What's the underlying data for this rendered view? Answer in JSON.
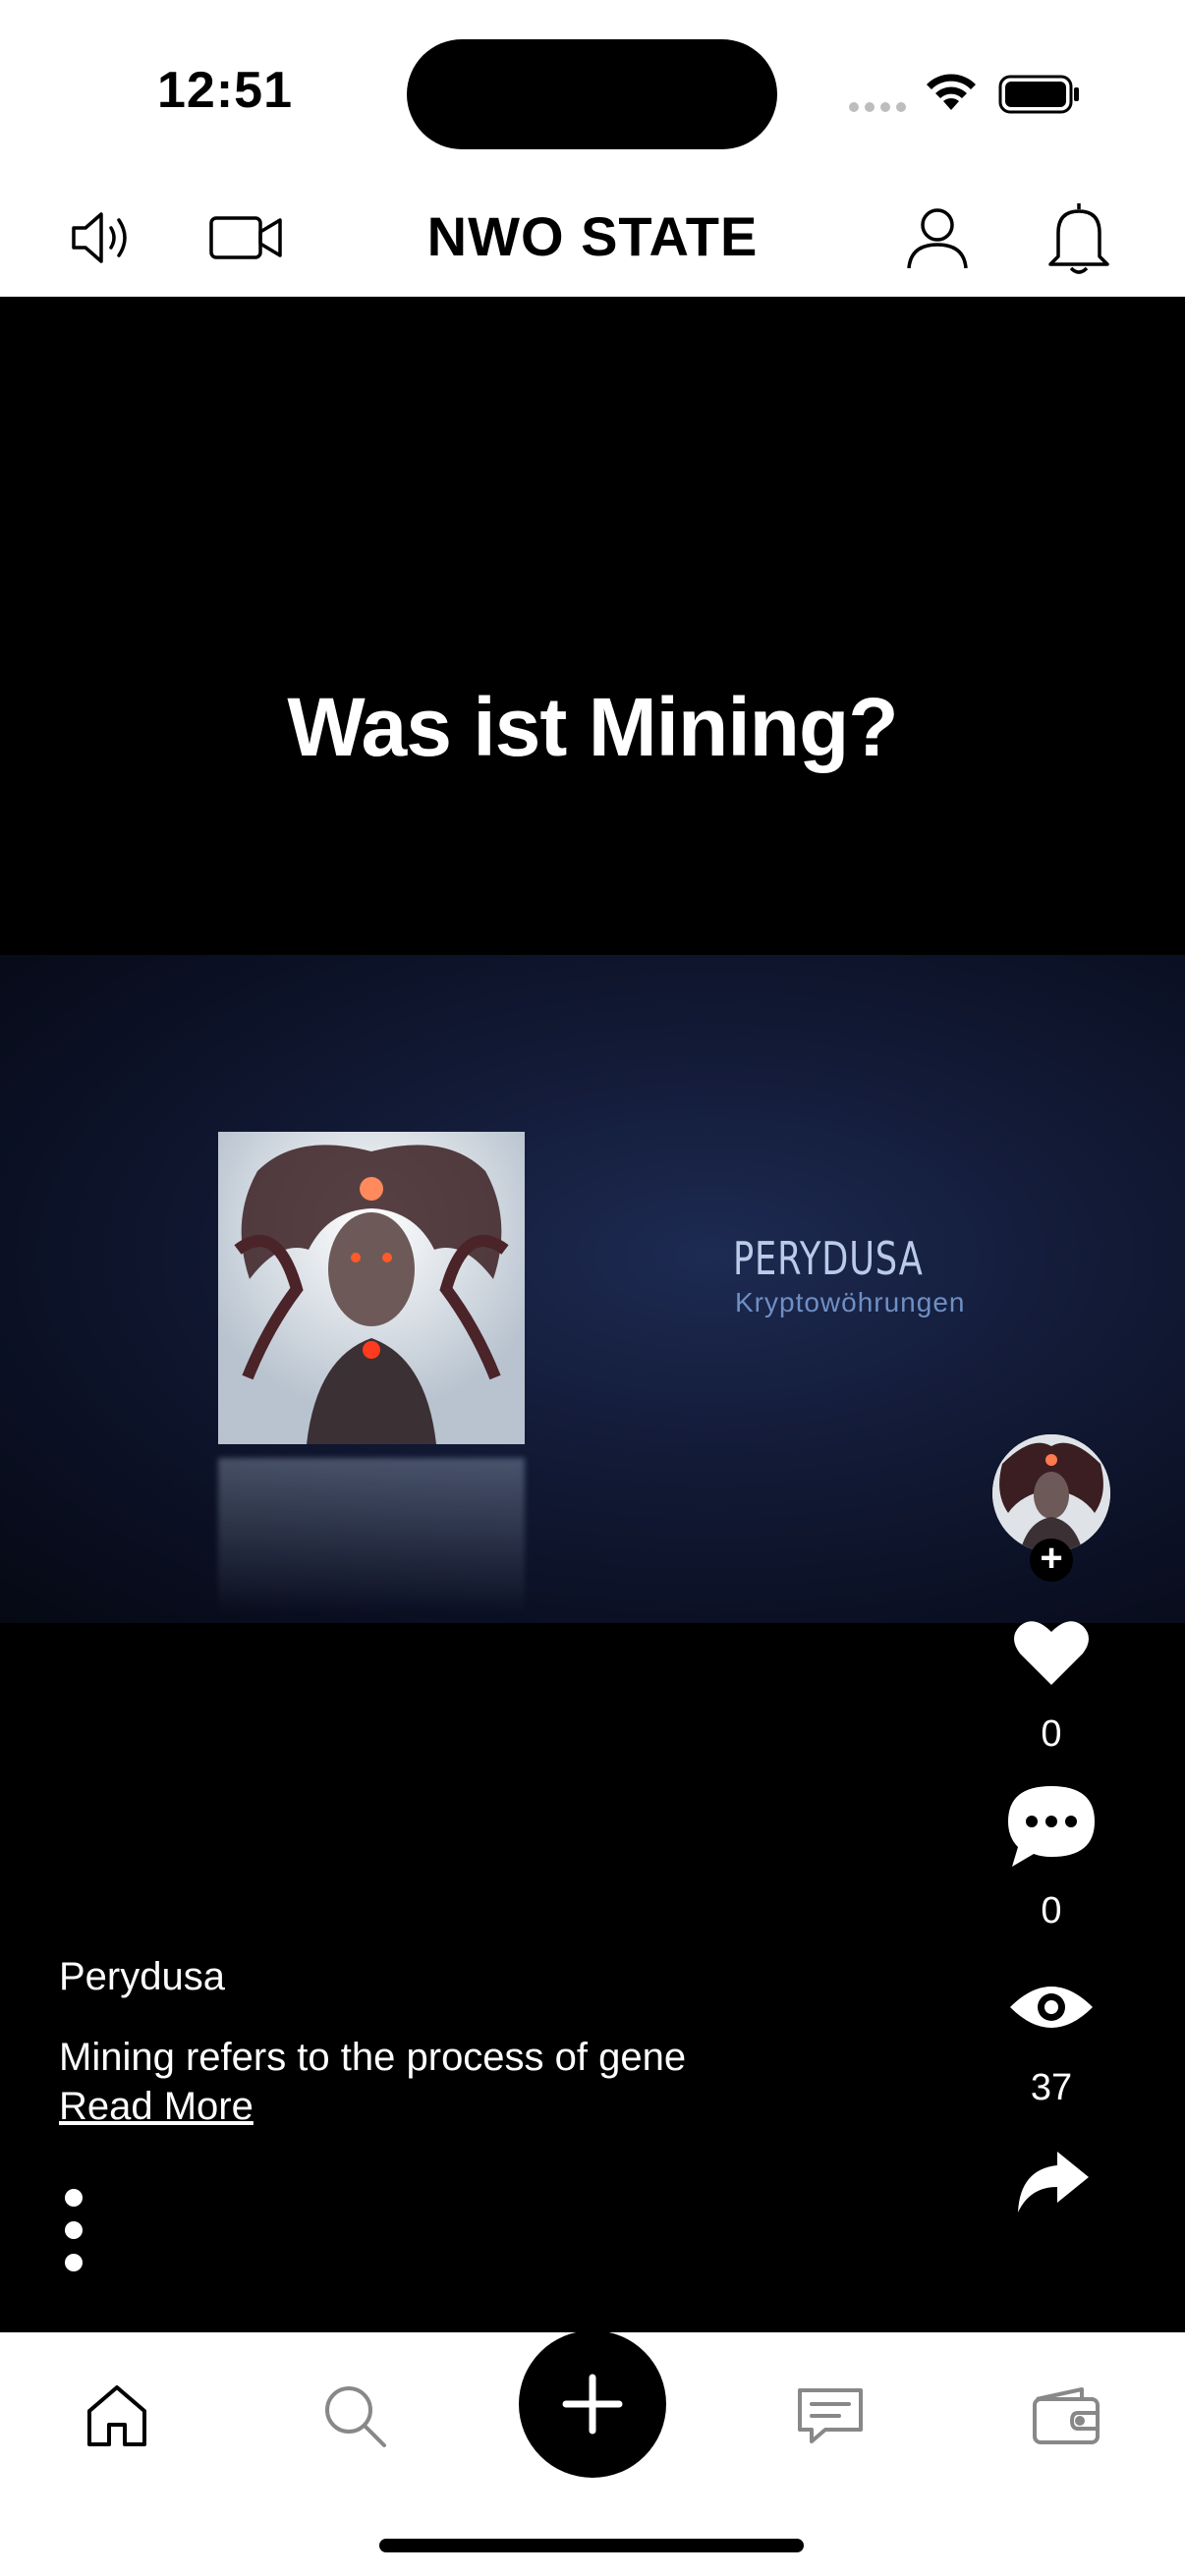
{
  "status_bar": {
    "time": "12:51"
  },
  "header": {
    "title": "NWO STATE",
    "icons": [
      "speaker-icon",
      "video-camera-icon",
      "profile-icon",
      "bell-icon"
    ]
  },
  "video": {
    "headline": "Was ist Mining?",
    "banner": {
      "brand": "PERYDUSA",
      "subtitle": "Kryptowöhrungen"
    }
  },
  "actions": {
    "likes": "0",
    "comments": "0",
    "views": "37"
  },
  "post": {
    "author": "Perydusa",
    "description": "Mining refers to the process of gene",
    "read_more": "Read More"
  },
  "bottom_nav": {
    "items": [
      "home-icon",
      "search-icon",
      "add-icon",
      "messages-icon",
      "wallet-icon"
    ]
  },
  "colors": {
    "background": "#000000",
    "header_bg": "#ffffff",
    "banner_text": "#b9cbe8",
    "banner_subtext": "#6f8fc4"
  }
}
